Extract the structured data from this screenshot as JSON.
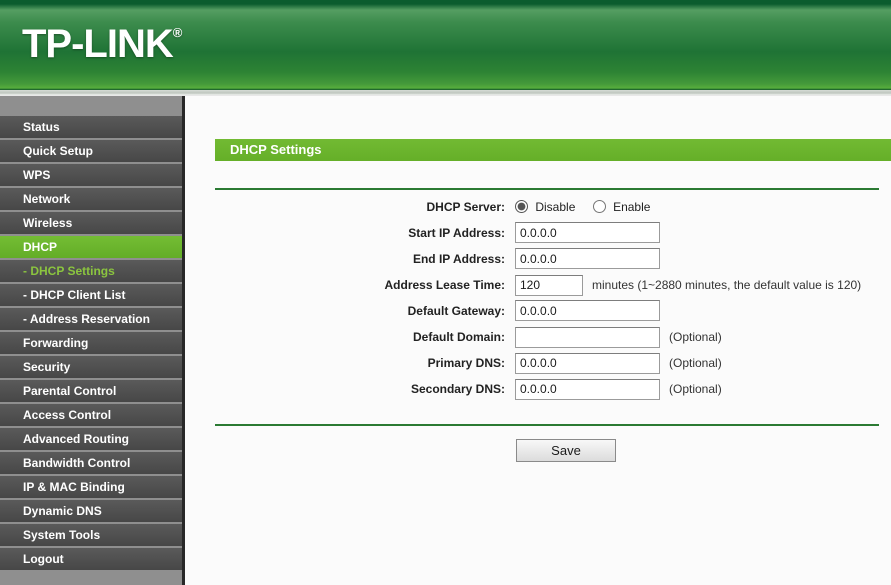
{
  "header": {
    "logo_text": "TP-LINK",
    "registered_mark": "®"
  },
  "sidebar": {
    "items": [
      {
        "label": "Status"
      },
      {
        "label": "Quick Setup"
      },
      {
        "label": "WPS"
      },
      {
        "label": "Network"
      },
      {
        "label": "Wireless"
      },
      {
        "label": "DHCP"
      },
      {
        "label": "- DHCP Settings"
      },
      {
        "label": "- DHCP Client List"
      },
      {
        "label": "- Address Reservation"
      },
      {
        "label": "Forwarding"
      },
      {
        "label": "Security"
      },
      {
        "label": "Parental Control"
      },
      {
        "label": "Access Control"
      },
      {
        "label": "Advanced Routing"
      },
      {
        "label": "Bandwidth Control"
      },
      {
        "label": "IP & MAC Binding"
      },
      {
        "label": "Dynamic DNS"
      },
      {
        "label": "System Tools"
      },
      {
        "label": "Logout"
      }
    ],
    "active_item": "DHCP",
    "active_subitem": "- DHCP Settings"
  },
  "main": {
    "title": "DHCP Settings",
    "form": {
      "dhcp_server": {
        "label": "DHCP Server:",
        "options": [
          "Disable",
          "Enable"
        ],
        "selected": "Disable"
      },
      "start_ip": {
        "label": "Start IP Address:",
        "value": "0.0.0.0",
        "note": ""
      },
      "end_ip": {
        "label": "End IP Address:",
        "value": "0.0.0.0",
        "note": ""
      },
      "lease_time": {
        "label": "Address Lease Time:",
        "value": "120",
        "note": "minutes (1~2880 minutes, the default value is 120)"
      },
      "gateway": {
        "label": "Default Gateway:",
        "value": "0.0.0.0",
        "note": ""
      },
      "domain": {
        "label": "Default Domain:",
        "value": "",
        "note": "(Optional)"
      },
      "primary_dns": {
        "label": "Primary DNS:",
        "value": "0.0.0.0",
        "note": "(Optional)"
      },
      "secondary_dns": {
        "label": "Secondary DNS:",
        "value": "0.0.0.0",
        "note": "(Optional)"
      },
      "save_label": "Save"
    }
  },
  "colors": {
    "accent_green": "#6cb52d",
    "header_green_dark": "#0b5c2e",
    "header_green_mid": "#1f7335",
    "sidebar_bg": "#8f8f8f",
    "sidebar_item_bg": "#4d4d4d",
    "active_subitem_text": "#8bc53f",
    "rule_green": "#2b7a33"
  }
}
